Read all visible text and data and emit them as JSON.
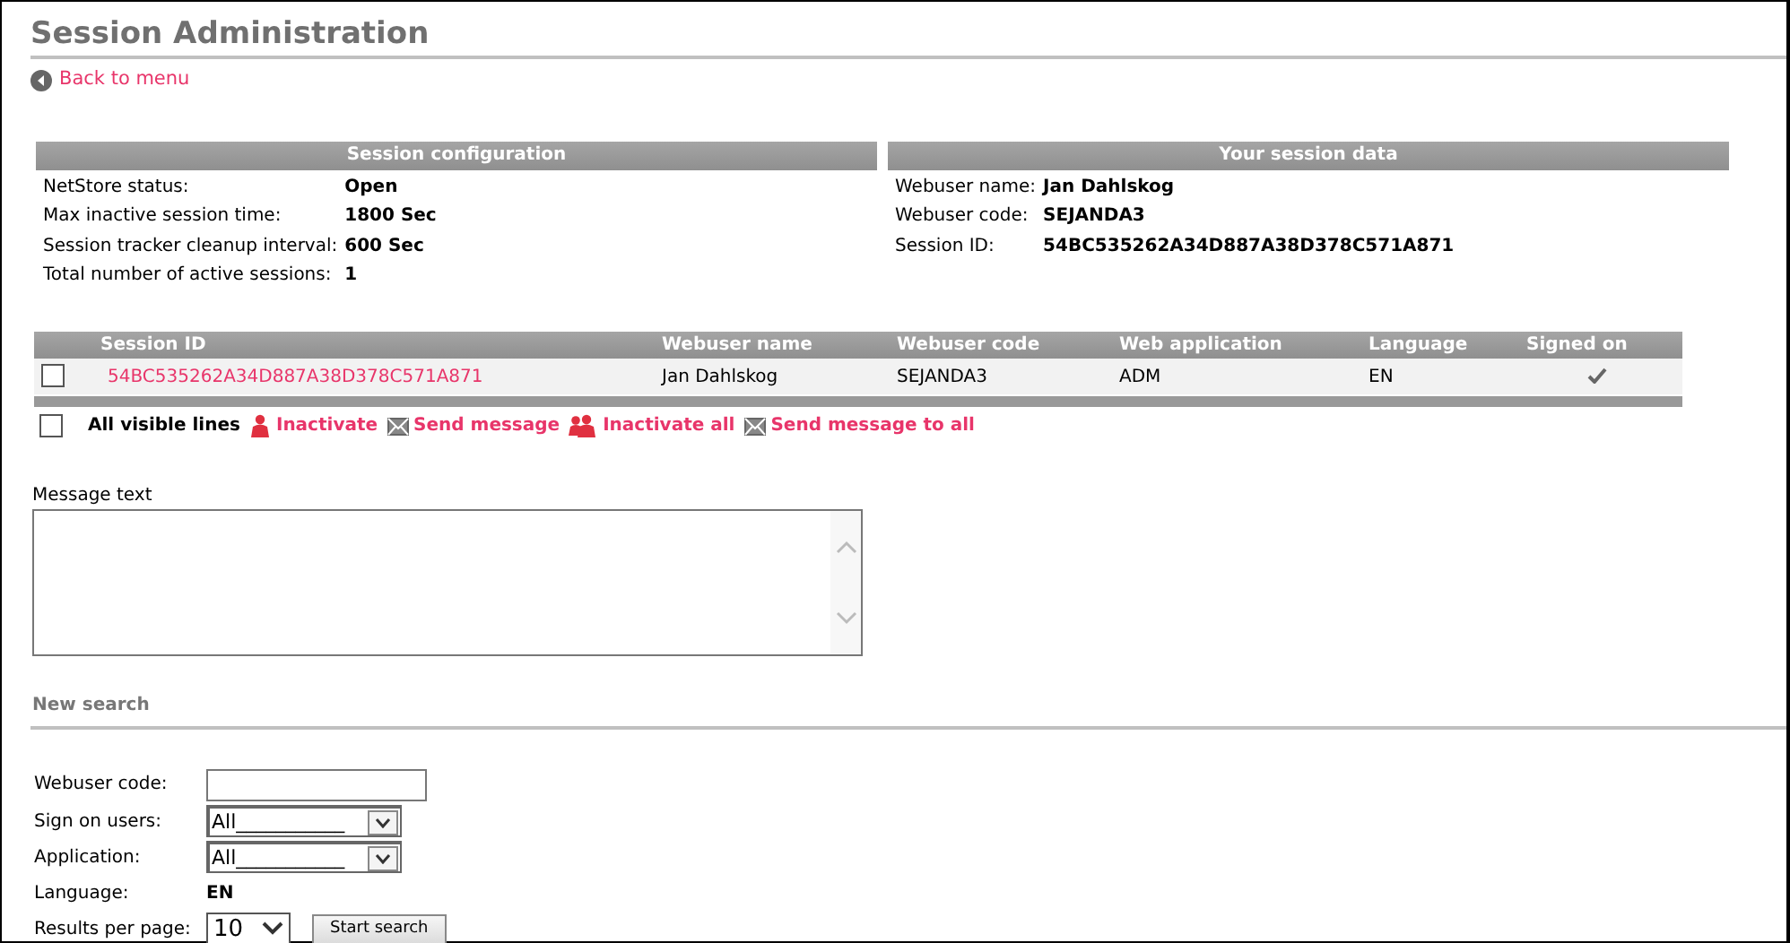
{
  "title": "Session Administration",
  "back_link": "Back to menu",
  "session_configuration": {
    "title": "Session configuration",
    "rows": [
      {
        "label": "NetStore status:",
        "value": "Open"
      },
      {
        "label": "Max inactive session time:",
        "value": "1800 Sec"
      },
      {
        "label": "Session tracker cleanup interval:",
        "value": "600 Sec"
      },
      {
        "label": "Total number of active sessions:",
        "value": "1"
      }
    ]
  },
  "your_session_data": {
    "title": "Your session data",
    "rows": [
      {
        "label": "Webuser name:",
        "value": "Jan Dahlskog"
      },
      {
        "label": "Webuser code:",
        "value": "SEJANDA3"
      },
      {
        "label": "Session ID:",
        "value": "54BC535262A34D887A38D378C571A871"
      }
    ]
  },
  "sessions_table": {
    "columns": [
      "Session ID",
      "Webuser name",
      "Webuser code",
      "Web application",
      "Language",
      "Signed on"
    ],
    "rows": [
      {
        "selected": false,
        "session_id": "54BC535262A34D887A38D378C571A871",
        "webuser_name": "Jan Dahlskog",
        "webuser_code": "SEJANDA3",
        "web_application": "ADM",
        "language": "EN",
        "signed_on": true
      }
    ]
  },
  "actions": {
    "select_all": {
      "label": "All visible lines",
      "checked": false
    },
    "items": [
      {
        "kind": "inactivate",
        "label": "Inactivate"
      },
      {
        "kind": "message",
        "label": "Send message"
      },
      {
        "kind": "inactivate_all",
        "label": "Inactivate all"
      },
      {
        "kind": "message",
        "label": "Send message to all"
      }
    ]
  },
  "message": {
    "label": "Message text"
  },
  "new_search": {
    "title": "New search",
    "fields": [
      {
        "kind": "text",
        "label": "Webuser code:"
      },
      {
        "kind": "select",
        "label": "Sign on users:",
        "value": "All___________"
      },
      {
        "kind": "select",
        "label": "Application:",
        "value": "All___________"
      },
      {
        "kind": "static",
        "label": "Language:",
        "value": "EN"
      },
      {
        "kind": "small_select",
        "label": "Results per page:",
        "value": "10"
      }
    ],
    "button": "Start search"
  }
}
